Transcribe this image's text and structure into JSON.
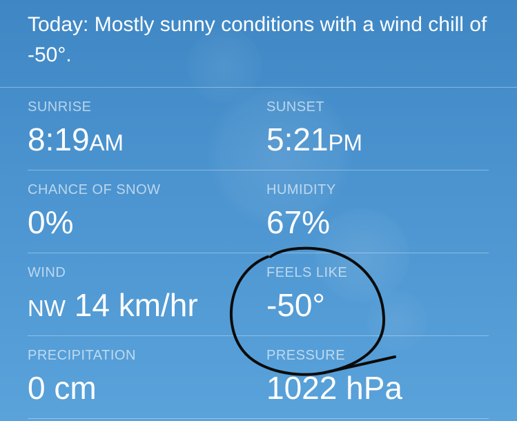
{
  "summary": "Today: Mostly sunny conditions with a wind chill of -50°.",
  "details": {
    "sunrise": {
      "label": "SUNRISE",
      "time": "8:19",
      "period": "AM"
    },
    "sunset": {
      "label": "SUNSET",
      "time": "5:21",
      "period": "PM"
    },
    "chance_of_snow": {
      "label": "CHANCE OF SNOW",
      "value": "0%"
    },
    "humidity": {
      "label": "HUMIDITY",
      "value": "67%"
    },
    "wind": {
      "label": "WIND",
      "direction": "NW",
      "speed": "14 km/hr"
    },
    "feels_like": {
      "label": "FEELS LIKE",
      "value": "-50°"
    },
    "precipitation": {
      "label": "PRECIPITATION",
      "value": "0 cm"
    },
    "pressure": {
      "label": "PRESSURE",
      "value": "1022 hPa"
    }
  },
  "colors": {
    "background_top": "#3f87c4",
    "background_bottom": "#5aa2da",
    "text": "#ffffff",
    "label_text": "rgba(255,255,255,0.62)",
    "annotation_ink": "#0b0b0b"
  },
  "annotation": "hand-drawn black circle around feels-like value"
}
